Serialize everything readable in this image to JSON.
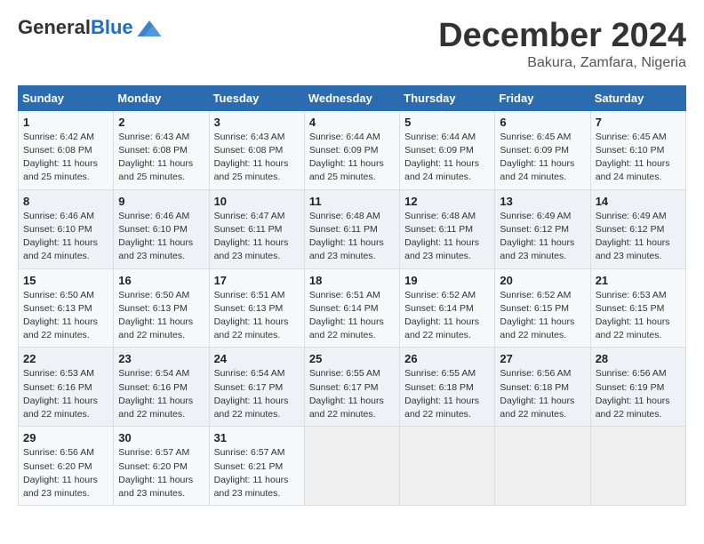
{
  "header": {
    "logo_general": "General",
    "logo_blue": "Blue",
    "month_title": "December 2024",
    "subtitle": "Bakura, Zamfara, Nigeria"
  },
  "calendar": {
    "days_of_week": [
      "Sunday",
      "Monday",
      "Tuesday",
      "Wednesday",
      "Thursday",
      "Friday",
      "Saturday"
    ],
    "weeks": [
      [
        {
          "day": "1",
          "info": "Sunrise: 6:42 AM\nSunset: 6:08 PM\nDaylight: 11 hours and 25 minutes."
        },
        {
          "day": "2",
          "info": "Sunrise: 6:43 AM\nSunset: 6:08 PM\nDaylight: 11 hours and 25 minutes."
        },
        {
          "day": "3",
          "info": "Sunrise: 6:43 AM\nSunset: 6:08 PM\nDaylight: 11 hours and 25 minutes."
        },
        {
          "day": "4",
          "info": "Sunrise: 6:44 AM\nSunset: 6:09 PM\nDaylight: 11 hours and 25 minutes."
        },
        {
          "day": "5",
          "info": "Sunrise: 6:44 AM\nSunset: 6:09 PM\nDaylight: 11 hours and 24 minutes."
        },
        {
          "day": "6",
          "info": "Sunrise: 6:45 AM\nSunset: 6:09 PM\nDaylight: 11 hours and 24 minutes."
        },
        {
          "day": "7",
          "info": "Sunrise: 6:45 AM\nSunset: 6:10 PM\nDaylight: 11 hours and 24 minutes."
        }
      ],
      [
        {
          "day": "8",
          "info": "Sunrise: 6:46 AM\nSunset: 6:10 PM\nDaylight: 11 hours and 24 minutes."
        },
        {
          "day": "9",
          "info": "Sunrise: 6:46 AM\nSunset: 6:10 PM\nDaylight: 11 hours and 23 minutes."
        },
        {
          "day": "10",
          "info": "Sunrise: 6:47 AM\nSunset: 6:11 PM\nDaylight: 11 hours and 23 minutes."
        },
        {
          "day": "11",
          "info": "Sunrise: 6:48 AM\nSunset: 6:11 PM\nDaylight: 11 hours and 23 minutes."
        },
        {
          "day": "12",
          "info": "Sunrise: 6:48 AM\nSunset: 6:11 PM\nDaylight: 11 hours and 23 minutes."
        },
        {
          "day": "13",
          "info": "Sunrise: 6:49 AM\nSunset: 6:12 PM\nDaylight: 11 hours and 23 minutes."
        },
        {
          "day": "14",
          "info": "Sunrise: 6:49 AM\nSunset: 6:12 PM\nDaylight: 11 hours and 23 minutes."
        }
      ],
      [
        {
          "day": "15",
          "info": "Sunrise: 6:50 AM\nSunset: 6:13 PM\nDaylight: 11 hours and 22 minutes."
        },
        {
          "day": "16",
          "info": "Sunrise: 6:50 AM\nSunset: 6:13 PM\nDaylight: 11 hours and 22 minutes."
        },
        {
          "day": "17",
          "info": "Sunrise: 6:51 AM\nSunset: 6:13 PM\nDaylight: 11 hours and 22 minutes."
        },
        {
          "day": "18",
          "info": "Sunrise: 6:51 AM\nSunset: 6:14 PM\nDaylight: 11 hours and 22 minutes."
        },
        {
          "day": "19",
          "info": "Sunrise: 6:52 AM\nSunset: 6:14 PM\nDaylight: 11 hours and 22 minutes."
        },
        {
          "day": "20",
          "info": "Sunrise: 6:52 AM\nSunset: 6:15 PM\nDaylight: 11 hours and 22 minutes."
        },
        {
          "day": "21",
          "info": "Sunrise: 6:53 AM\nSunset: 6:15 PM\nDaylight: 11 hours and 22 minutes."
        }
      ],
      [
        {
          "day": "22",
          "info": "Sunrise: 6:53 AM\nSunset: 6:16 PM\nDaylight: 11 hours and 22 minutes."
        },
        {
          "day": "23",
          "info": "Sunrise: 6:54 AM\nSunset: 6:16 PM\nDaylight: 11 hours and 22 minutes."
        },
        {
          "day": "24",
          "info": "Sunrise: 6:54 AM\nSunset: 6:17 PM\nDaylight: 11 hours and 22 minutes."
        },
        {
          "day": "25",
          "info": "Sunrise: 6:55 AM\nSunset: 6:17 PM\nDaylight: 11 hours and 22 minutes."
        },
        {
          "day": "26",
          "info": "Sunrise: 6:55 AM\nSunset: 6:18 PM\nDaylight: 11 hours and 22 minutes."
        },
        {
          "day": "27",
          "info": "Sunrise: 6:56 AM\nSunset: 6:18 PM\nDaylight: 11 hours and 22 minutes."
        },
        {
          "day": "28",
          "info": "Sunrise: 6:56 AM\nSunset: 6:19 PM\nDaylight: 11 hours and 22 minutes."
        }
      ],
      [
        {
          "day": "29",
          "info": "Sunrise: 6:56 AM\nSunset: 6:20 PM\nDaylight: 11 hours and 23 minutes."
        },
        {
          "day": "30",
          "info": "Sunrise: 6:57 AM\nSunset: 6:20 PM\nDaylight: 11 hours and 23 minutes."
        },
        {
          "day": "31",
          "info": "Sunrise: 6:57 AM\nSunset: 6:21 PM\nDaylight: 11 hours and 23 minutes."
        },
        {
          "day": "",
          "info": ""
        },
        {
          "day": "",
          "info": ""
        },
        {
          "day": "",
          "info": ""
        },
        {
          "day": "",
          "info": ""
        }
      ]
    ]
  }
}
